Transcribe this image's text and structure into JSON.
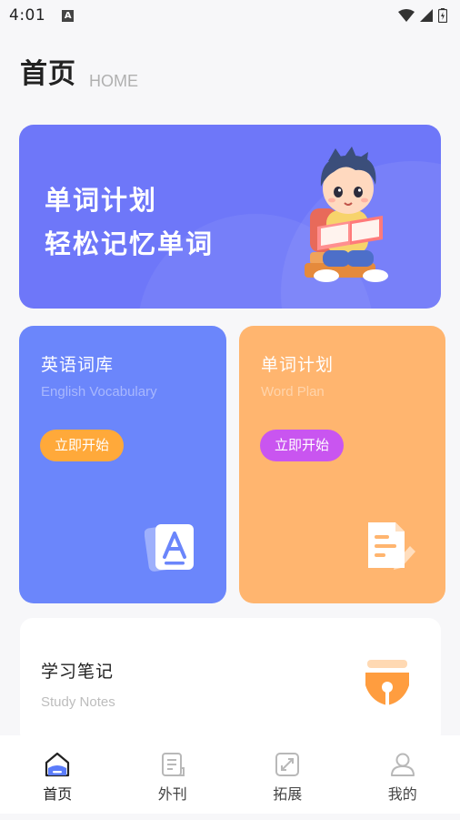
{
  "status_bar": {
    "time": "4:01",
    "notification_letter": "A"
  },
  "header": {
    "title": "首页",
    "subtitle": "HOME"
  },
  "banner": {
    "line1": "单词计划",
    "line2": "轻松记忆单词"
  },
  "cards": [
    {
      "title": "英语词库",
      "subtitle": "English Vocabulary",
      "button": "立即开始",
      "icon": "vocabulary-a-icon"
    },
    {
      "title": "单词计划",
      "subtitle": "Word Plan",
      "button": "立即开始",
      "icon": "edit-document-icon"
    }
  ],
  "notes": {
    "title": "学习笔记",
    "subtitle": "Study Notes",
    "icon": "pen-nib-icon"
  },
  "tabbar": [
    {
      "label": "首页",
      "icon": "home-icon",
      "active": true
    },
    {
      "label": "外刊",
      "icon": "document-icon",
      "active": false
    },
    {
      "label": "拓展",
      "icon": "expand-icon",
      "active": false
    },
    {
      "label": "我的",
      "icon": "profile-icon",
      "active": false
    }
  ],
  "colors": {
    "banner": "#6e77f9",
    "vocab_card": "#6b86fb",
    "plan_card": "#ffb56f",
    "vocab_button": "#ffa93a",
    "plan_button": "#c955f0",
    "background": "#f7f7f9"
  }
}
